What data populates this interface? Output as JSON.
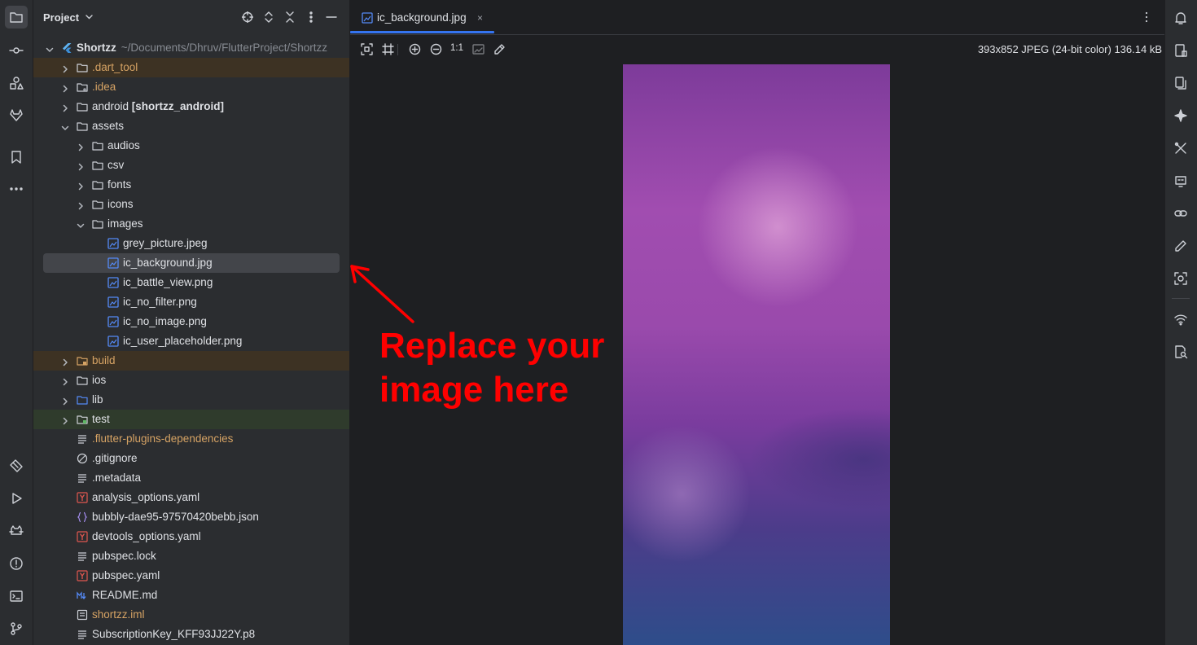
{
  "project_panel": {
    "title": "Project",
    "tree": [
      {
        "label": "Shortzz",
        "path": "~/Documents/Dhruv/FlutterProject/Shortzz",
        "depth": 0,
        "chevron": "down",
        "icon": "flutter-icon",
        "bold": true
      },
      {
        "label": ".dart_tool",
        "depth": 1,
        "chevron": "right",
        "icon": "folder-icon",
        "color": "orange",
        "highlight": "orange"
      },
      {
        "label": ".idea",
        "depth": 1,
        "chevron": "right",
        "icon": "folder-config-icon",
        "color": "orange"
      },
      {
        "label": "android",
        "module": "[shortzz_android]",
        "depth": 1,
        "chevron": "right",
        "icon": "folder-icon"
      },
      {
        "label": "assets",
        "depth": 1,
        "chevron": "down",
        "icon": "folder-icon"
      },
      {
        "label": "audios",
        "depth": 2,
        "chevron": "right",
        "icon": "folder-icon"
      },
      {
        "label": "csv",
        "depth": 2,
        "chevron": "right",
        "icon": "folder-icon"
      },
      {
        "label": "fonts",
        "depth": 2,
        "chevron": "right",
        "icon": "folder-icon"
      },
      {
        "label": "icons",
        "depth": 2,
        "chevron": "right",
        "icon": "folder-icon"
      },
      {
        "label": "images",
        "depth": 2,
        "chevron": "down",
        "icon": "folder-icon"
      },
      {
        "label": "grey_picture.jpeg",
        "depth": 3,
        "icon": "image-file-icon"
      },
      {
        "label": "ic_background.jpg",
        "depth": 3,
        "icon": "image-file-icon",
        "selected": true
      },
      {
        "label": "ic_battle_view.png",
        "depth": 3,
        "icon": "image-file-icon"
      },
      {
        "label": "ic_no_filter.png",
        "depth": 3,
        "icon": "image-file-icon"
      },
      {
        "label": "ic_no_image.png",
        "depth": 3,
        "icon": "image-file-icon"
      },
      {
        "label": "ic_user_placeholder.png",
        "depth": 3,
        "icon": "image-file-icon"
      },
      {
        "label": "build",
        "depth": 1,
        "chevron": "right",
        "icon": "folder-excluded-icon",
        "color": "orange",
        "highlight": "orange"
      },
      {
        "label": "ios",
        "depth": 1,
        "chevron": "right",
        "icon": "folder-icon"
      },
      {
        "label": "lib",
        "depth": 1,
        "chevron": "right",
        "icon": "folder-source-icon"
      },
      {
        "label": "test",
        "depth": 1,
        "chevron": "right",
        "icon": "folder-test-icon",
        "highlight": "green"
      },
      {
        "label": ".flutter-plugins-dependencies",
        "depth": 1,
        "icon": "text-file-icon",
        "color": "orange"
      },
      {
        "label": ".gitignore",
        "depth": 1,
        "icon": "ignore-file-icon"
      },
      {
        "label": ".metadata",
        "depth": 1,
        "icon": "text-file-icon"
      },
      {
        "label": "analysis_options.yaml",
        "depth": 1,
        "icon": "yaml-file-icon"
      },
      {
        "label": "bubbly-dae95-97570420bebb.json",
        "depth": 1,
        "icon": "json-file-icon"
      },
      {
        "label": "devtools_options.yaml",
        "depth": 1,
        "icon": "yaml-file-icon"
      },
      {
        "label": "pubspec.lock",
        "depth": 1,
        "icon": "text-file-icon"
      },
      {
        "label": "pubspec.yaml",
        "depth": 1,
        "icon": "yaml-file-icon"
      },
      {
        "label": "README.md",
        "depth": 1,
        "icon": "markdown-file-icon"
      },
      {
        "label": "shortzz.iml",
        "depth": 1,
        "icon": "iml-file-icon",
        "color": "orange"
      },
      {
        "label": "SubscriptionKey_KFF93JJ22Y.p8",
        "depth": 1,
        "icon": "text-file-icon"
      }
    ]
  },
  "editor": {
    "tab_label": "ic_background.jpg",
    "tab_close": "×",
    "zoom_actual_label": "1:1",
    "image_info": "393x852 JPEG (24-bit color) 136.14 kB"
  },
  "annotation": {
    "text": "Replace your image here",
    "color": "#ff0000"
  },
  "colors": {
    "accent": "#3574f0",
    "excluded_text": "#d6a364",
    "orange_highlight": "#3d3223",
    "green_highlight": "#2f3b2c"
  }
}
